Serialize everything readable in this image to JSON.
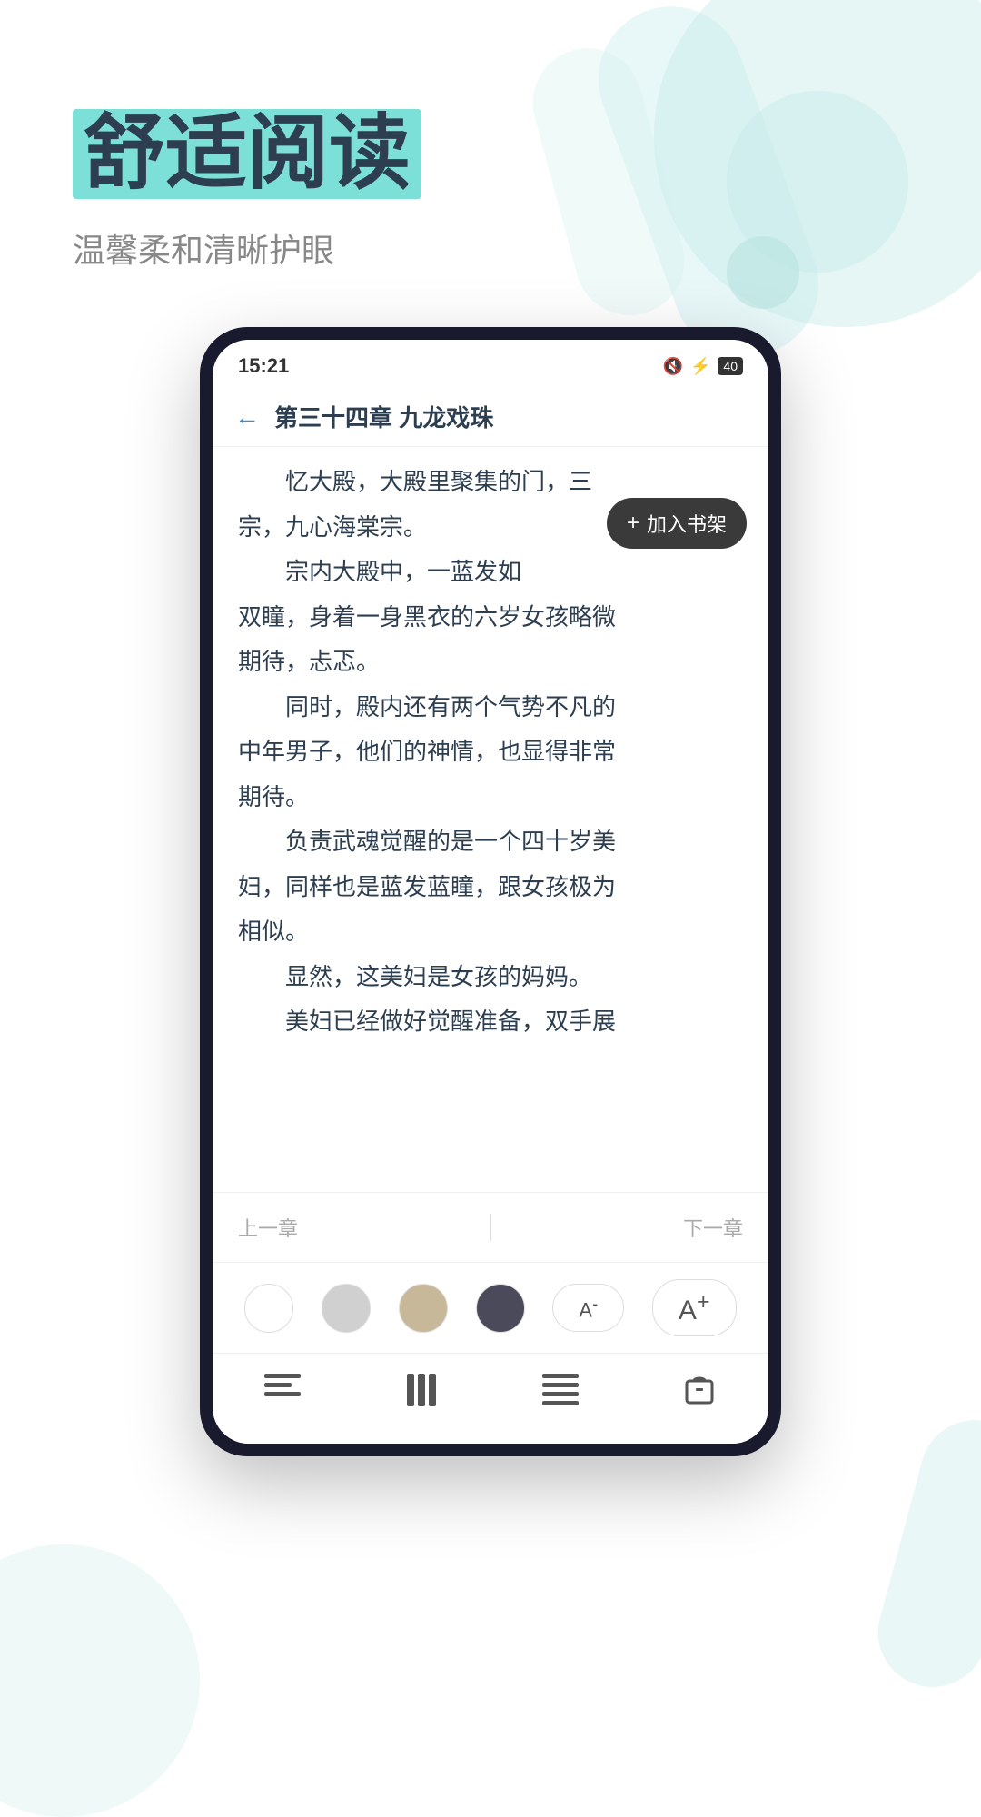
{
  "hero": {
    "title_part1": "舒适阅读",
    "subtitle": "温馨柔和清晰护眼"
  },
  "status_bar": {
    "time": "15:21",
    "battery": "40"
  },
  "reader": {
    "chapter_title": "第三十四章 九龙戏珠",
    "add_shelf_label": "加入书架",
    "content_lines": [
      "宗，九心海棠宗。",
      "宗内大殿中，一蓝发如",
      "双瞳，身着一身黑衣的六岁女孩略微",
      "期待，忐忑。",
      "同时，殿内还有两个气势不凡的",
      "中年男子，他们的神情，也显得非常",
      "期待。",
      "负责武魂觉醒的是一个四十岁美",
      "妇，同样也是蓝发蓝瞳，跟女孩极为",
      "相似。",
      "显然，这美妇是女孩的妈妈。",
      "美妇已经做好觉醒准备，双手展"
    ],
    "prev_chapter": "上一章",
    "next_chapter": "下一章",
    "font_decrease": "A⁻",
    "font_increase": "A⁺"
  },
  "bottom_nav": {
    "items": [
      {
        "icon": "≡",
        "name": "menu"
      },
      {
        "icon": "☰",
        "name": "catalog"
      },
      {
        "icon": "≡",
        "name": "settings"
      },
      {
        "icon": "⊟",
        "name": "cart"
      }
    ]
  }
}
